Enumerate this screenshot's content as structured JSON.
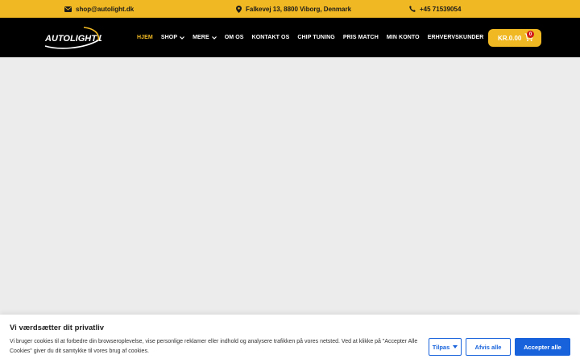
{
  "topbar": {
    "email": "shop@autolight.dk",
    "address": "Falkevej 13, 8800 Viborg, Denmark",
    "phone": "+45 71539054"
  },
  "header": {
    "logo_text": "AUTOLIGHT.DK",
    "menu": [
      {
        "label": "HJEM",
        "active": true,
        "dropdown": false
      },
      {
        "label": "SHOP",
        "active": false,
        "dropdown": true
      },
      {
        "label": "MERE",
        "active": false,
        "dropdown": true
      },
      {
        "label": "OM OS",
        "active": false,
        "dropdown": false
      },
      {
        "label": "KONTAKT OS",
        "active": false,
        "dropdown": false
      },
      {
        "label": "CHIP TUNING",
        "active": false,
        "dropdown": false
      },
      {
        "label": "PRIS MATCH",
        "active": false,
        "dropdown": false
      },
      {
        "label": "MIN KONTO",
        "active": false,
        "dropdown": false
      },
      {
        "label": "ERHVERVSKUNDER",
        "active": false,
        "dropdown": false
      }
    ],
    "cart_total": "KR.0.00",
    "cart_count": "0"
  },
  "cookie": {
    "title": "Vi værdsætter dit privatliv",
    "text": "Vi bruger cookies til at forbedre din browseroplevelse, vise personlige reklamer eller indhold og analysere trafikken på vores netsted. Ved at klikke på \"Accepter Alle Cookies\" giver du dit samtykke til vores brug af cookies.",
    "customize_label": "Tilpas",
    "reject_label": "Afvis alle",
    "accept_label": "Accepter alle"
  },
  "colors": {
    "brand_yellow": "#f0b823",
    "nav_black": "#000000",
    "cookie_blue": "#1863dc",
    "badge_red": "#d11a1a"
  }
}
